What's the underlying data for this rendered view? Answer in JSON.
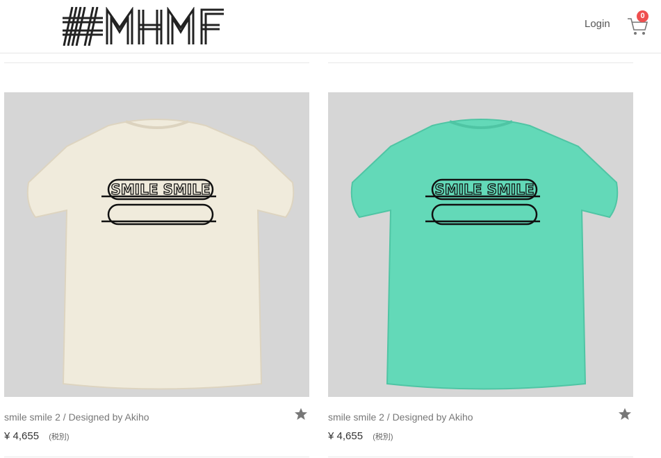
{
  "header": {
    "logo_text": "#MHMF",
    "login_label": "Login",
    "cart_count": "0"
  },
  "products": [
    {
      "title": "smile smile 2 / Designed by Akiho",
      "price": "¥ 4,655",
      "tax_note": "(税別)",
      "shirt_color": "#f0ebdc",
      "graphic_text": "SMILE SMILE"
    },
    {
      "title": "smile smile 2 / Designed by Akiho",
      "price": "¥ 4,655",
      "tax_note": "(税別)",
      "shirt_color": "#63d9b8",
      "graphic_text": "SMILE SMILE"
    }
  ],
  "colors": {
    "badge": "#ef4f4f",
    "star": "#777777",
    "photo_bg": "#d9d9d9"
  },
  "icons": [
    "logo",
    "cart-icon",
    "star-icon"
  ]
}
